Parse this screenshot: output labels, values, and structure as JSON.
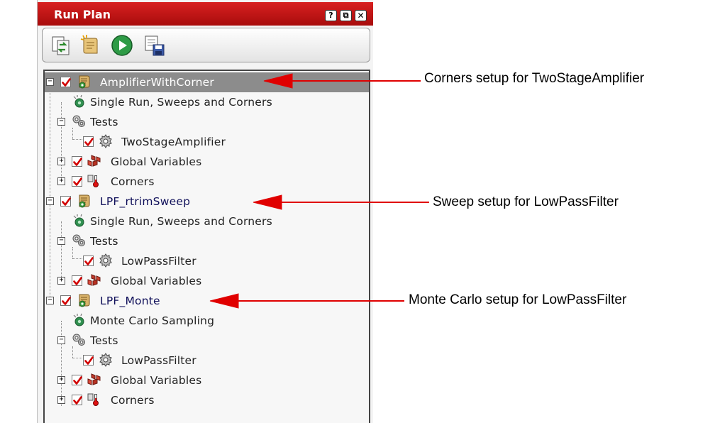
{
  "panel": {
    "title": "Run Plan",
    "title_buttons": {
      "help": "?",
      "restore": "⧉",
      "close": "✕"
    },
    "accent_color": "#c01414",
    "toolbar": [
      "refresh-icon",
      "script-icon",
      "run-icon",
      "save-icon"
    ]
  },
  "tree": {
    "setups": [
      {
        "name": "AmplifierWithCorner",
        "selected": true,
        "children": {
          "run_mode": "Single Run, Sweeps and Corners",
          "tests_label": "Tests",
          "test": "TwoStageAmplifier",
          "global_vars": "Global Variables",
          "corners": "Corners"
        }
      },
      {
        "name": "LPF_rtrimSweep",
        "children": {
          "run_mode": "Single Run, Sweeps and Corners",
          "tests_label": "Tests",
          "test": "LowPassFilter",
          "global_vars": "Global Variables"
        }
      },
      {
        "name": "LPF_Monte",
        "children": {
          "run_mode": "Monte Carlo Sampling",
          "tests_label": "Tests",
          "test": "LowPassFilter",
          "global_vars": "Global Variables",
          "corners": "Corners"
        }
      }
    ]
  },
  "annotations": {
    "corners": "Corners setup for TwoStageAmplifier",
    "sweep": "Sweep setup for LowPassFilter",
    "monte": "Monte Carlo setup for LowPassFilter",
    "arrow_color": "#e00000"
  }
}
